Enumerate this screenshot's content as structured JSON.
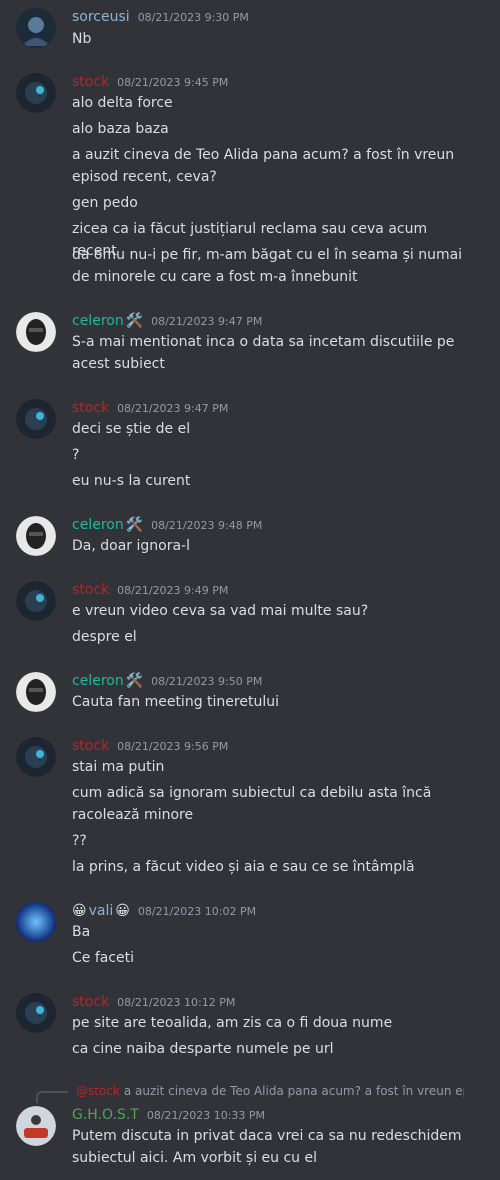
{
  "colors": {
    "background": "#313338",
    "text": "#dbdee1",
    "timestamp": "#949ba4",
    "sorceusi": "#8ab4d6",
    "stock": "#b3262a",
    "celeron": "#1abc9c",
    "vali": "#8ab4d6",
    "ghost": "#4fa556"
  },
  "messages": [
    {
      "user": "sorceusi",
      "timestamp": "08/21/2023 9:30 PM",
      "lines": [
        "Nb"
      ]
    },
    {
      "user": "stock",
      "timestamp": "08/21/2023 9:45 PM",
      "lines": [
        "alo delta force",
        "alo baza baza",
        "a auzit cineva de Teo Alida pana acum? a fost în vreun",
        "episod recent, ceva?",
        "gen pedo",
        "zicea ca ia făcut justițiarul reclama sau ceva acum recent",
        "da omu nu-i pe fir, m-am băgat cu el în seama și numai",
        "de minorele cu care a fost m-a înnebunit"
      ]
    },
    {
      "user": "celeron",
      "badge_icon": "hammer-wrench-icon",
      "timestamp": "08/21/2023 9:47 PM",
      "lines": [
        "S-a mai mentionat inca o data sa incetam discutiile pe",
        "acest subiect"
      ]
    },
    {
      "user": "stock",
      "timestamp": "08/21/2023 9:47 PM",
      "lines": [
        "deci se știe de el",
        "?",
        "eu nu-s la curent"
      ]
    },
    {
      "user": "celeron",
      "badge_icon": "hammer-wrench-icon",
      "timestamp": "08/21/2023 9:48 PM",
      "lines": [
        "Da, doar ignora-l"
      ]
    },
    {
      "user": "stock",
      "timestamp": "08/21/2023 9:49 PM",
      "lines": [
        "e vreun video ceva sa vad mai multe sau?",
        "despre el"
      ]
    },
    {
      "user": "celeron",
      "badge_icon": "hammer-wrench-icon",
      "timestamp": "08/21/2023 9:50 PM",
      "lines": [
        "Cauta fan meeting tineretului"
      ]
    },
    {
      "user": "stock",
      "timestamp": "08/21/2023 9:56 PM",
      "lines": [
        "stai ma putin",
        "cum adică sa ignoram subiectul ca debilu asta încă",
        "racolează minore",
        "??",
        "la prins, a făcut video și aia e sau ce se întâmplă"
      ]
    },
    {
      "user": "vali",
      "prefix_emoji": "😀",
      "suffix_emoji": "😀",
      "timestamp": "08/21/2023 10:02 PM",
      "lines": [
        "Ba",
        "Ce faceti"
      ]
    },
    {
      "user": "stock",
      "timestamp": "08/21/2023 10:12 PM",
      "lines": [
        "pe site are teoalida, am zis ca o fi doua nume",
        "ca cine naiba desparte numele pe url"
      ]
    },
    {
      "user": "G.H.O.S.T",
      "timestamp": "08/21/2023 10:33 PM",
      "reply_to": {
        "user": "@stock",
        "text": "a auzit cineva de Teo Alida pana acum? a fost în vreun episod recent, ceva?"
      },
      "lines": [
        "Putem discuta in privat daca vrei ca sa nu redeschidem",
        "subiectul aici. Am vorbit și eu cu el"
      ]
    }
  ]
}
